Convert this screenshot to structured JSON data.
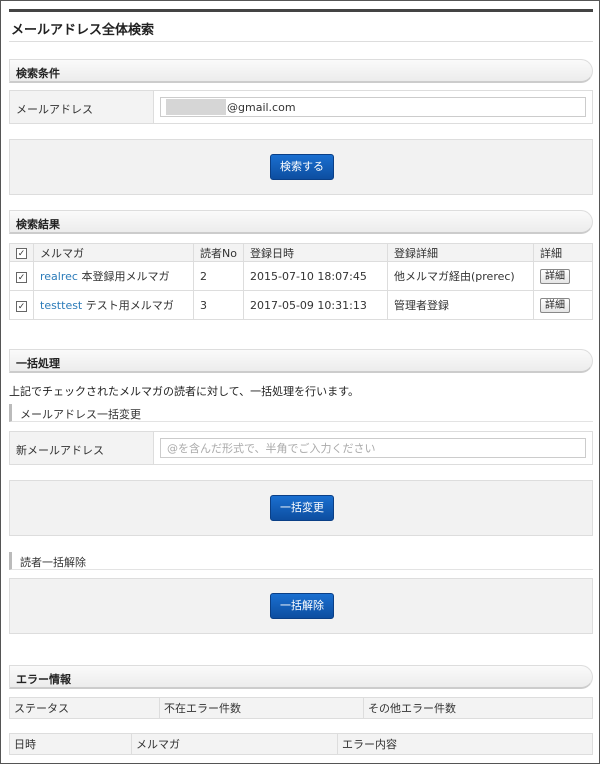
{
  "page": {
    "title": "メールアドレス全体検索"
  },
  "search": {
    "heading": "検索条件",
    "email_label": "メールアドレス",
    "email_value": "@gmail.com",
    "button_label": "検索する"
  },
  "results": {
    "heading": "検索結果",
    "headers": [
      "",
      "メルマガ",
      "読者No",
      "登録日時",
      "登録詳細",
      "詳細"
    ],
    "rows": [
      {
        "checked": "✓",
        "link": "realrec",
        "name": "本登録用メルマガ",
        "reader_no": "2",
        "registered": "2015-07-10 18:07:45",
        "detail": "他メルマガ経由(prerec)",
        "button": "詳細"
      },
      {
        "checked": "✓",
        "link": "testtest",
        "name": "テスト用メルマガ",
        "reader_no": "3",
        "registered": "2017-05-09 10:31:13",
        "detail": "管理者登録",
        "button": "詳細"
      }
    ]
  },
  "bulk": {
    "heading": "一括処理",
    "description": "上記でチェックされたメルマガの読者に対して、一括処理を行います。",
    "change_heading": "メールアドレス一括変更",
    "new_email_label": "新メールアドレス",
    "new_email_placeholder": "@を含んだ形式で、半角でご入力ください",
    "change_button": "一括変更",
    "cancel_heading": "読者一括解除",
    "cancel_button": "一括解除"
  },
  "errors": {
    "heading": "エラー情報",
    "summary_headers": [
      "ステータス",
      "不在エラー件数",
      "その他エラー件数"
    ],
    "detail_headers": [
      "日時",
      "メルマガ",
      "エラー内容"
    ]
  }
}
